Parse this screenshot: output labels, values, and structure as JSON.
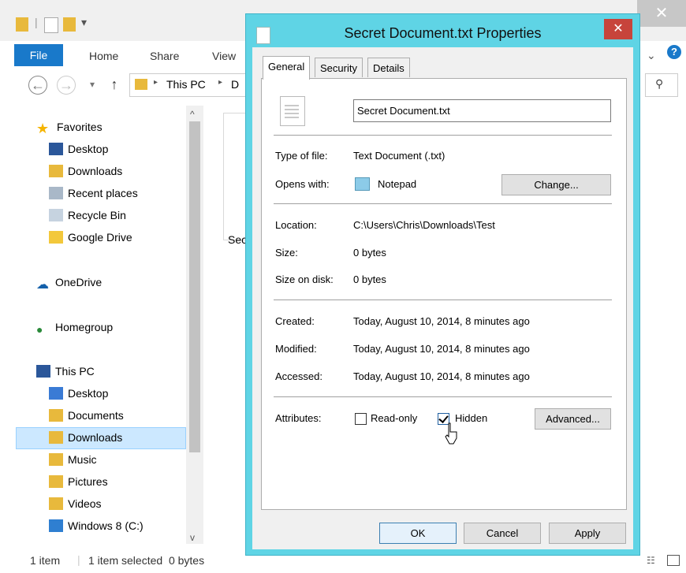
{
  "explorer": {
    "ribbon_tabs": [
      "File",
      "Home",
      "Share",
      "View"
    ],
    "breadcrumb": [
      "This PC",
      "D"
    ],
    "nav": {
      "favorites": "Favorites",
      "favorites_items": [
        "Desktop",
        "Downloads",
        "Recent places",
        "Recycle Bin",
        "Google Drive"
      ],
      "onedrive": "OneDrive",
      "homegroup": "Homegroup",
      "this_pc": "This PC",
      "this_pc_items": [
        "Desktop",
        "Documents",
        "Downloads",
        "Music",
        "Pictures",
        "Videos",
        "Windows 8 (C:)"
      ]
    },
    "content_item_label": "Sec",
    "status": {
      "count": "1 item",
      "selection": "1 item selected  0 bytes"
    }
  },
  "dialog": {
    "title": "Secret Document.txt Properties",
    "tabs": [
      "General",
      "Security",
      "Details"
    ],
    "filename": "Secret Document.txt",
    "type_label": "Type of file:",
    "type_value": "Text Document (.txt)",
    "opens_label": "Opens with:",
    "opens_value": "Notepad",
    "change_button": "Change...",
    "location_label": "Location:",
    "location_value": "C:\\Users\\Chris\\Downloads\\Test",
    "size_label": "Size:",
    "size_value": "0 bytes",
    "size_on_disk_label": "Size on disk:",
    "size_on_disk_value": "0 bytes",
    "created_label": "Created:",
    "created_value": "Today, August 10, 2014, 8 minutes ago",
    "modified_label": "Modified:",
    "modified_value": "Today, August 10, 2014, 8 minutes ago",
    "accessed_label": "Accessed:",
    "accessed_value": "Today, August 10, 2014, 8 minutes ago",
    "attributes_label": "Attributes:",
    "readonly_label": "Read-only",
    "hidden_label": "Hidden",
    "advanced_button": "Advanced...",
    "ok_button": "OK",
    "cancel_button": "Cancel",
    "apply_button": "Apply"
  },
  "colors": {
    "accent": "#1979ca",
    "dialog_frame": "#5fd4e5",
    "close_red": "#c7443b",
    "selection": "#cce8ff"
  }
}
